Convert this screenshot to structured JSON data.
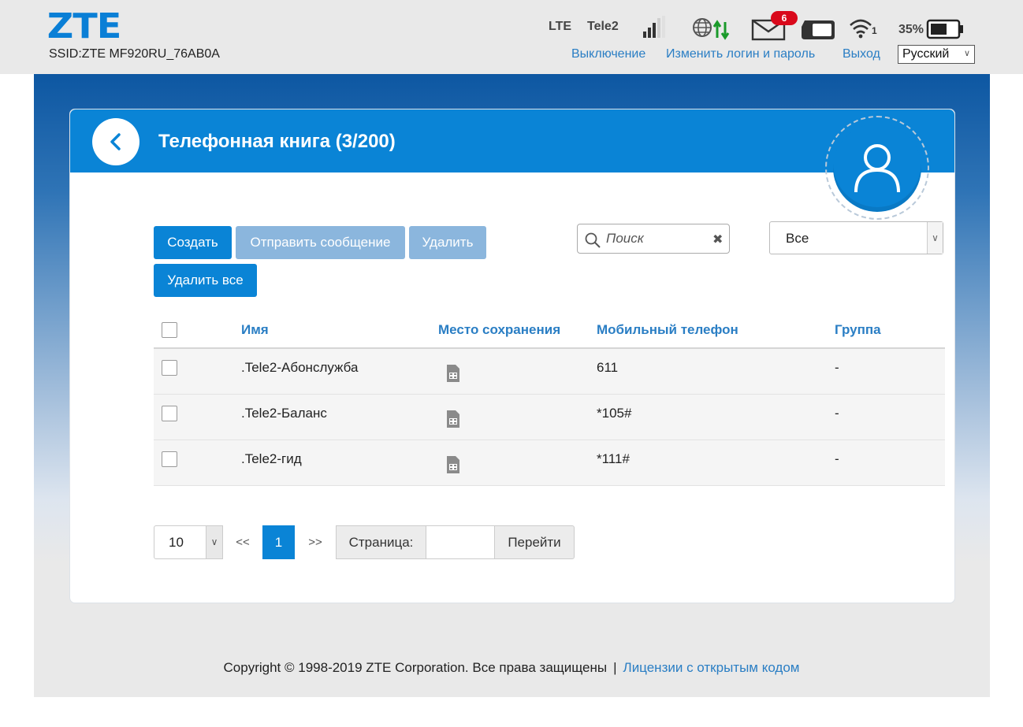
{
  "header": {
    "logo": "ZTE",
    "ssid": "SSID:ZTE MF920RU_76AB0A",
    "network_type": "LTE",
    "operator": "Tele2",
    "unread_messages": "6",
    "wifi_clients": "1",
    "battery_percent": "35%",
    "links": {
      "shutdown": "Выключение",
      "change_login": "Изменить логин и пароль",
      "logout": "Выход"
    },
    "language": "Русский"
  },
  "card": {
    "title": "Телефонная книга (3/200)"
  },
  "toolbar": {
    "create": "Создать",
    "send_message": "Отправить сообщение",
    "delete": "Удалить",
    "delete_all": "Удалить все"
  },
  "search": {
    "placeholder": "Поиск",
    "value": ""
  },
  "group_filter": {
    "selected": "Все"
  },
  "table": {
    "columns": {
      "name": "Имя",
      "location": "Место сохранения",
      "mobile": "Мобильный телефон",
      "group": "Группа"
    },
    "rows": [
      {
        "name": ".Tele2-Абонслужба",
        "location_icon": "sim-card-icon",
        "mobile": "611",
        "group": "-"
      },
      {
        "name": ".Tele2-Баланс",
        "location_icon": "sim-card-icon",
        "mobile": "*105#",
        "group": "-"
      },
      {
        "name": ".Tele2-гид",
        "location_icon": "sim-card-icon",
        "mobile": "*111#",
        "group": "-"
      }
    ]
  },
  "pagination": {
    "page_size": "10",
    "prev": "<<",
    "current_page": "1",
    "next": ">>",
    "page_label": "Страница:",
    "page_input": "",
    "go": "Перейти"
  },
  "footer": {
    "copyright": "Copyright © 1998-2019 ZTE Corporation. Все права защищены",
    "separator": "|",
    "license_link": "Лицензии с открытым кодом"
  },
  "colors": {
    "accent": "#0a84d6",
    "link": "#2a7ec4",
    "badge": "#d9091b",
    "data_arrow": "#1a9a2a"
  }
}
